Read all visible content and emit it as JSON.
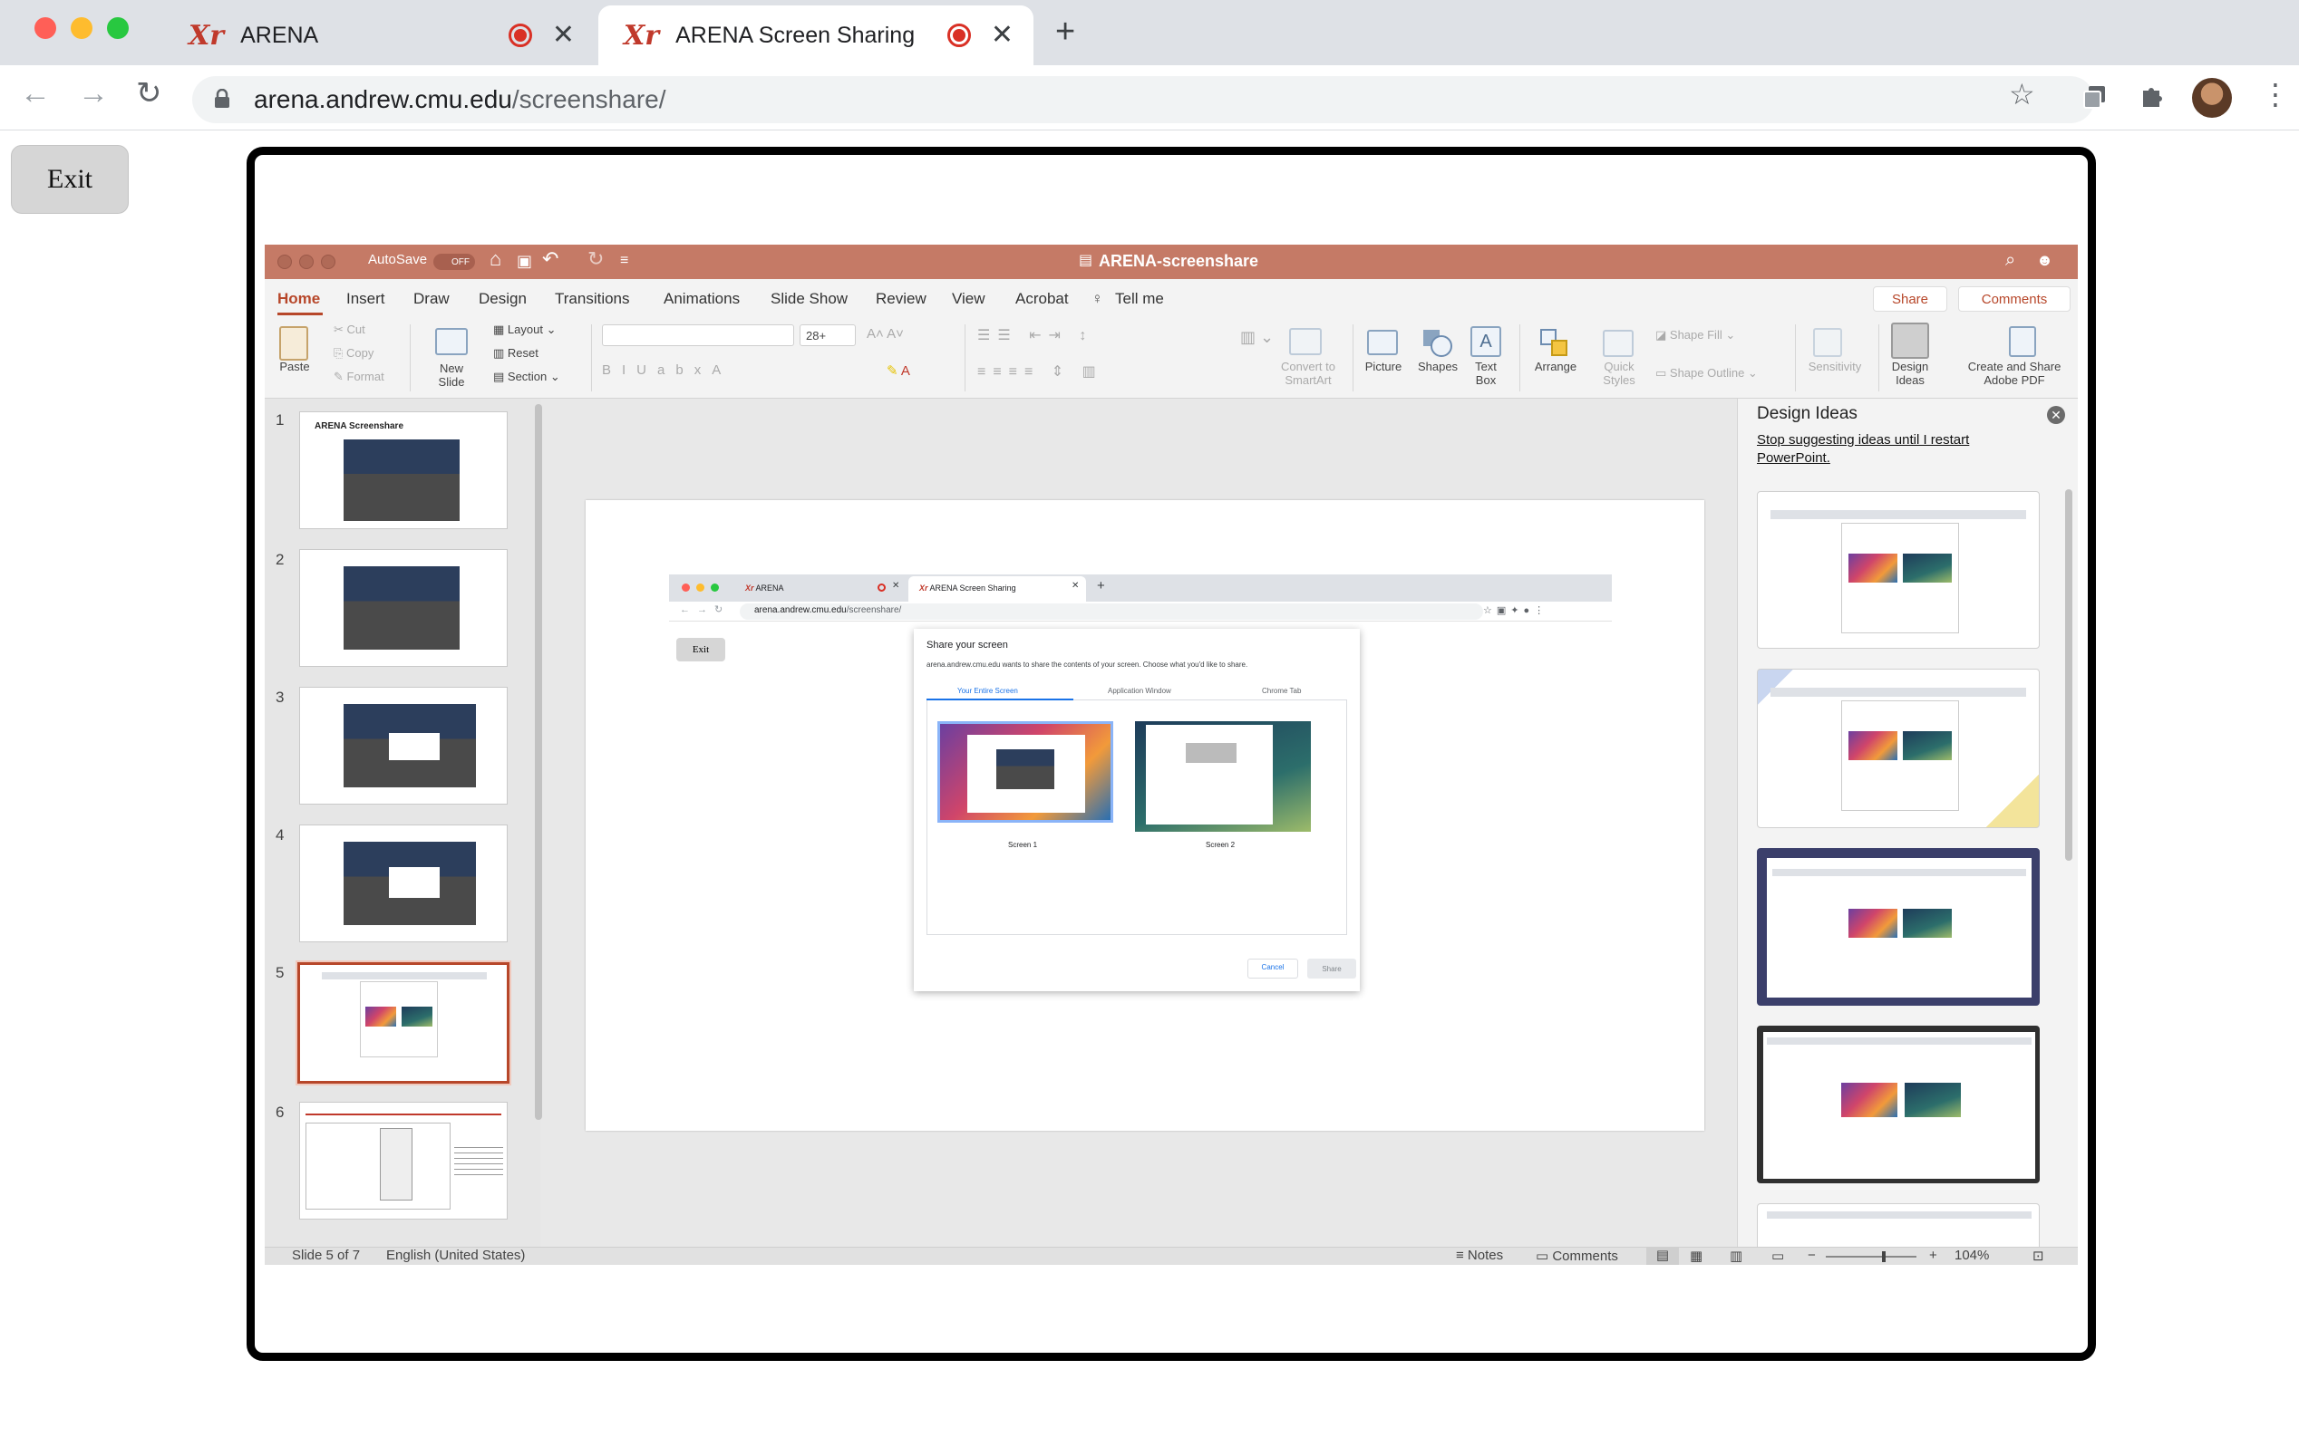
{
  "browser": {
    "tabs": [
      {
        "label": "ARENA",
        "logo": "Xr",
        "recording": true
      },
      {
        "label": "ARENA Screen Sharing",
        "logo": "Xr",
        "recording": true,
        "active": true
      }
    ],
    "url_host": "arena.andrew.cmu.edu",
    "url_path": "/screenshare/",
    "colors": {
      "tabstrip": "#dee1e6",
      "record": "#d93025",
      "logo": "#c0392b"
    }
  },
  "page": {
    "exit_label": "Exit"
  },
  "powerpoint": {
    "autosave_label": "AutoSave",
    "autosave_state": "OFF",
    "doc_title": "ARENA-screenshare",
    "ribbon_tabs": [
      "Home",
      "Insert",
      "Draw",
      "Design",
      "Transitions",
      "Animations",
      "Slide Show",
      "Review",
      "View",
      "Acrobat",
      "Tell me"
    ],
    "share_label": "Share",
    "comments_label": "Comments",
    "ribbon": {
      "paste": "Paste",
      "cut": "Cut",
      "copy": "Copy",
      "format": "Format",
      "new_slide": "New\nSlide",
      "layout": "Layout",
      "reset": "Reset",
      "section": "Section",
      "font_size": "28+",
      "convert_smartart": "Convert to\nSmartArt",
      "picture": "Picture",
      "shapes": "Shapes",
      "text_box": "Text\nBox",
      "arrange": "Arrange",
      "quick_styles": "Quick\nStyles",
      "shape_fill": "Shape Fill",
      "shape_outline": "Shape Outline",
      "sensitivity": "Sensitivity",
      "design_ideas": "Design\nIdeas",
      "create_pdf": "Create and Share\nAdobe PDF"
    },
    "thumbnails": [
      {
        "num": "1",
        "title": "ARENA Screenshare"
      },
      {
        "num": "2"
      },
      {
        "num": "3"
      },
      {
        "num": "4"
      },
      {
        "num": "5",
        "selected": true
      },
      {
        "num": "6"
      }
    ],
    "slide": {
      "tab1": "ARENA",
      "tab2": "ARENA Screen Sharing",
      "url_host": "arena.andrew.cmu.edu",
      "url_path": "/screenshare/",
      "exit": "Exit",
      "dialog_title": "Share your screen",
      "dialog_desc": "arena.andrew.cmu.edu wants to share the contents of your screen. Choose what you'd like to share.",
      "dialog_tabs": [
        "Your Entire Screen",
        "Application Window",
        "Chrome Tab"
      ],
      "screen1": "Screen 1",
      "screen2": "Screen 2",
      "cancel": "Cancel",
      "share": "Share"
    },
    "design_pane": {
      "title": "Design Ideas",
      "link": "Stop suggesting ideas until I restart PowerPoint."
    },
    "status": {
      "slide_info": "Slide 5 of 7",
      "language": "English (United States)",
      "notes": "Notes",
      "comments": "Comments",
      "zoom": "104%"
    },
    "colors": {
      "title_bar": "#c57a66",
      "accent": "#b7472a"
    }
  }
}
